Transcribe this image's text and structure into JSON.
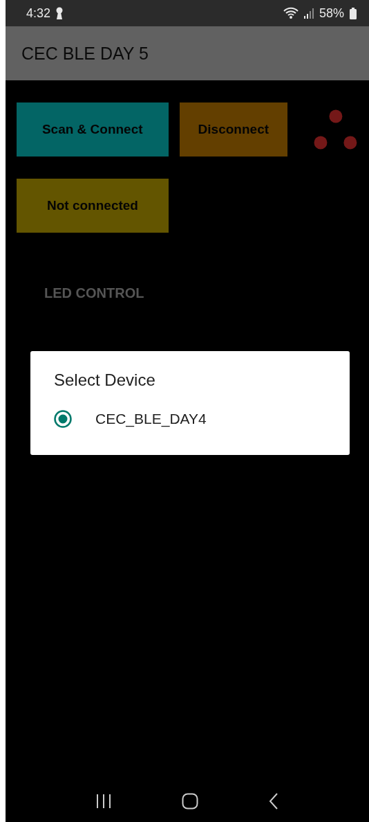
{
  "status_bar": {
    "time": "4:32",
    "battery": "58%"
  },
  "app_bar": {
    "title": "CEC BLE DAY 5"
  },
  "buttons": [
    {
      "label": "Scan & Connect",
      "color": "#036565"
    },
    {
      "label": "Disconnect",
      "color": "#633f00"
    }
  ],
  "connection_status": {
    "label": "Not connected",
    "color": "#635500"
  },
  "section_label": "LED CONTROL",
  "dialog": {
    "title": "Select Device",
    "options": [
      {
        "label": "CEC_BLE_DAY4",
        "selected": true
      }
    ]
  }
}
